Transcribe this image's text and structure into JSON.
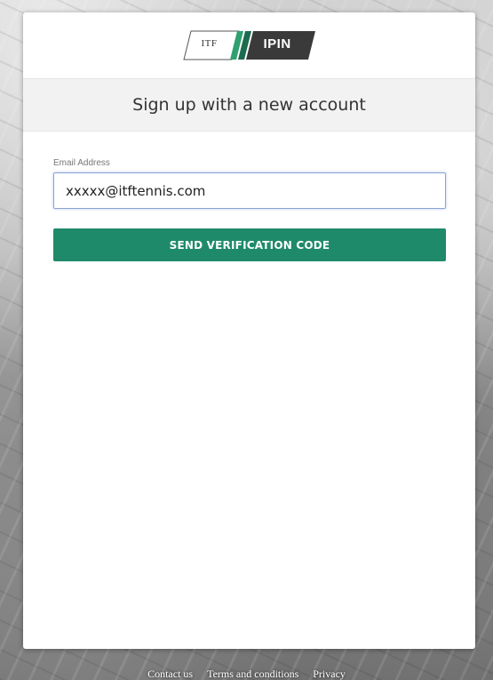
{
  "logo": {
    "itf_text": "ITF",
    "product_text": "IPIN",
    "accent_colors": [
      "#1e8a69",
      "#3a3a3a"
    ]
  },
  "header": {
    "title": "Sign up with a new account"
  },
  "form": {
    "email_label": "Email Address",
    "email_value": "xxxxx@itftennis.com",
    "send_button_label": "SEND VERIFICATION CODE",
    "button_color": "#1e8a69"
  },
  "footer": {
    "links": [
      "Contact us",
      "Terms and conditions",
      "Privacy"
    ]
  }
}
